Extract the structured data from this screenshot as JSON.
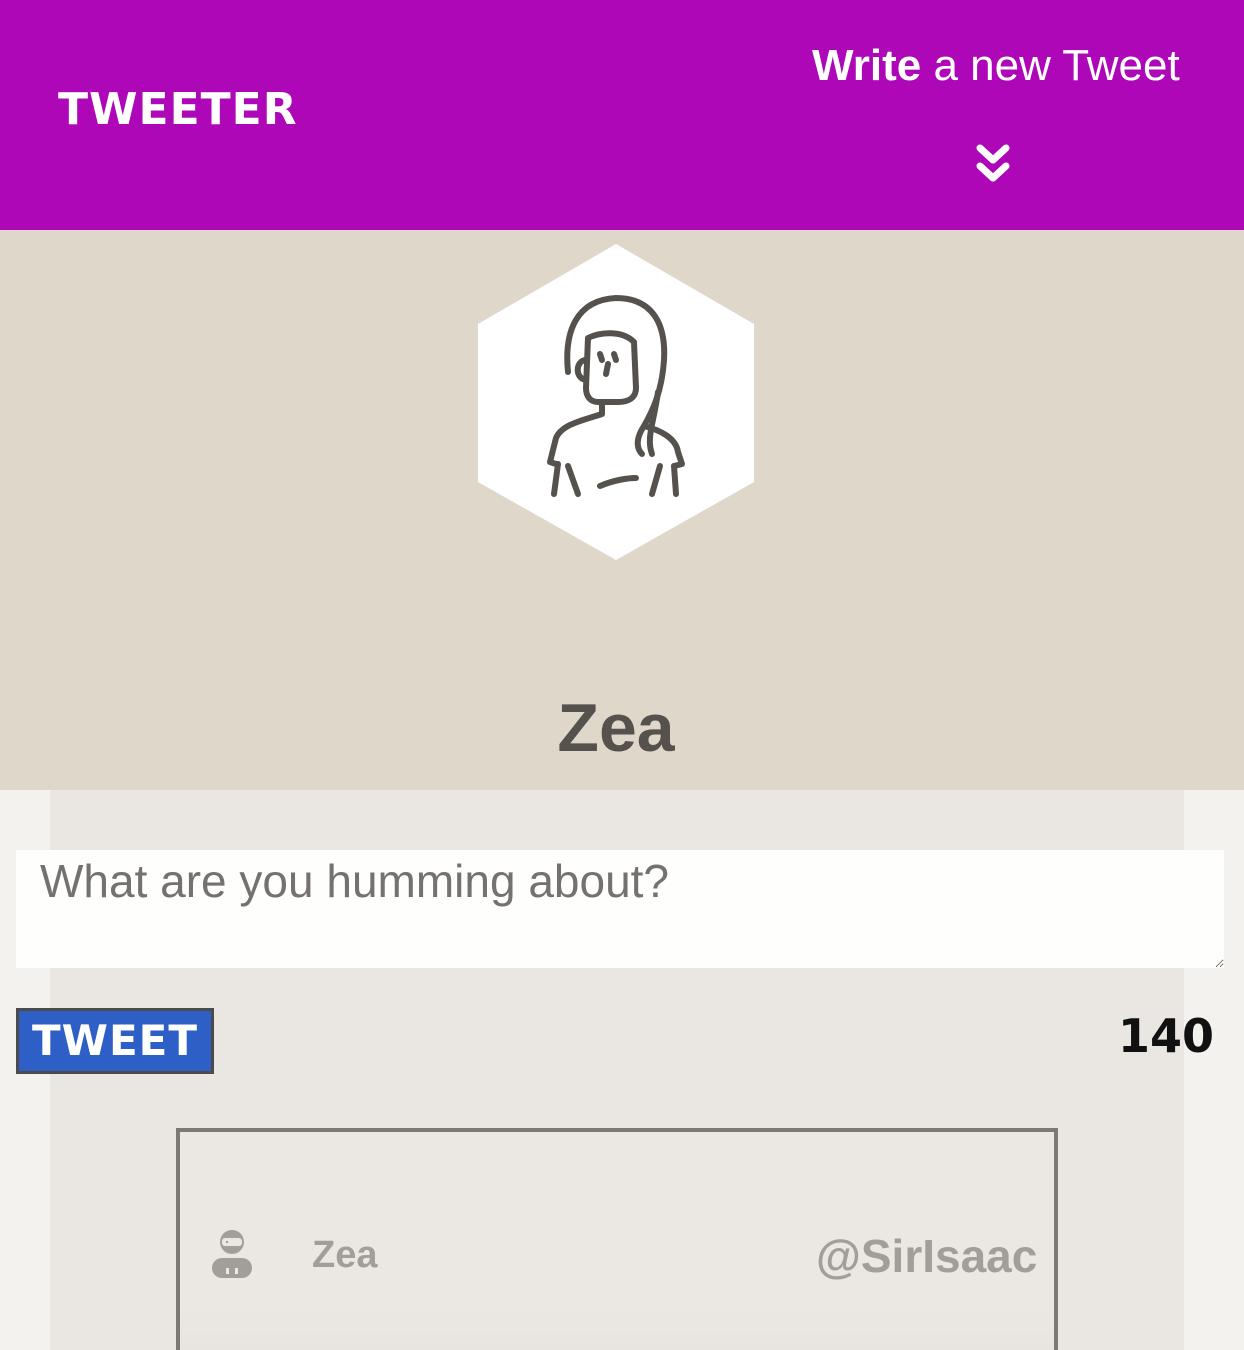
{
  "nav": {
    "brand": "TWEETER",
    "write_strong": "Write",
    "write_rest": "a new Tweet",
    "toggle_icon": "double-chevron-down-icon"
  },
  "profile": {
    "name": "Zea",
    "avatar_icon": "woman-avatar-icon"
  },
  "composer": {
    "placeholder": "What are you humming about?",
    "value": "",
    "submit_label": "TWEET",
    "char_count": "140"
  },
  "feed": {
    "tweets": [
      {
        "avatar_icon": "robot-avatar-icon",
        "name": "Zea",
        "handle": "@SirIsaac"
      }
    ]
  },
  "colors": {
    "nav_bg": "#ad07b8",
    "profile_bg": "#e0d7cb",
    "main_bg": "#eae6e1",
    "button_bg": "#2e5fc6",
    "text_dark": "#55524d",
    "text_muted": "#a29f9a"
  }
}
